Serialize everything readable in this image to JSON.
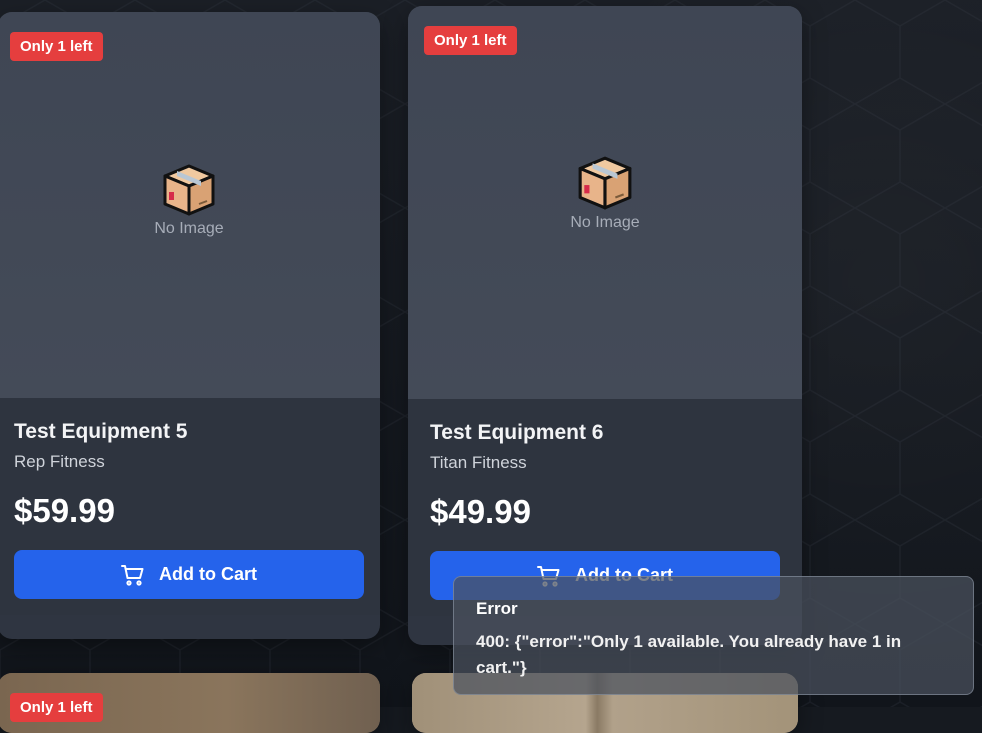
{
  "products": [
    {
      "badge": "Only 1 left",
      "no_image_label": "No Image",
      "title": "Test Equipment 5",
      "brand": "Rep Fitness",
      "price": "$59.99",
      "add_to_cart_label": "Add to Cart"
    },
    {
      "badge": "Only 1 left",
      "no_image_label": "No Image",
      "title": "Test Equipment 6",
      "brand": "Titan Fitness",
      "price": "$49.99",
      "add_to_cart_label": "Add to Cart"
    },
    {
      "badge": "Only 1 left"
    }
  ],
  "toast": {
    "title": "Error",
    "message": "400: {\"error\":\"Only 1 available. You already have 1 in cart.\"}"
  },
  "colors": {
    "badge": "#e53e3e",
    "button": "#2563eb",
    "card": "#2f3541",
    "background": "#161a20"
  },
  "icons": {
    "placeholder": "package-box-icon",
    "cart": "shopping-cart-icon"
  }
}
